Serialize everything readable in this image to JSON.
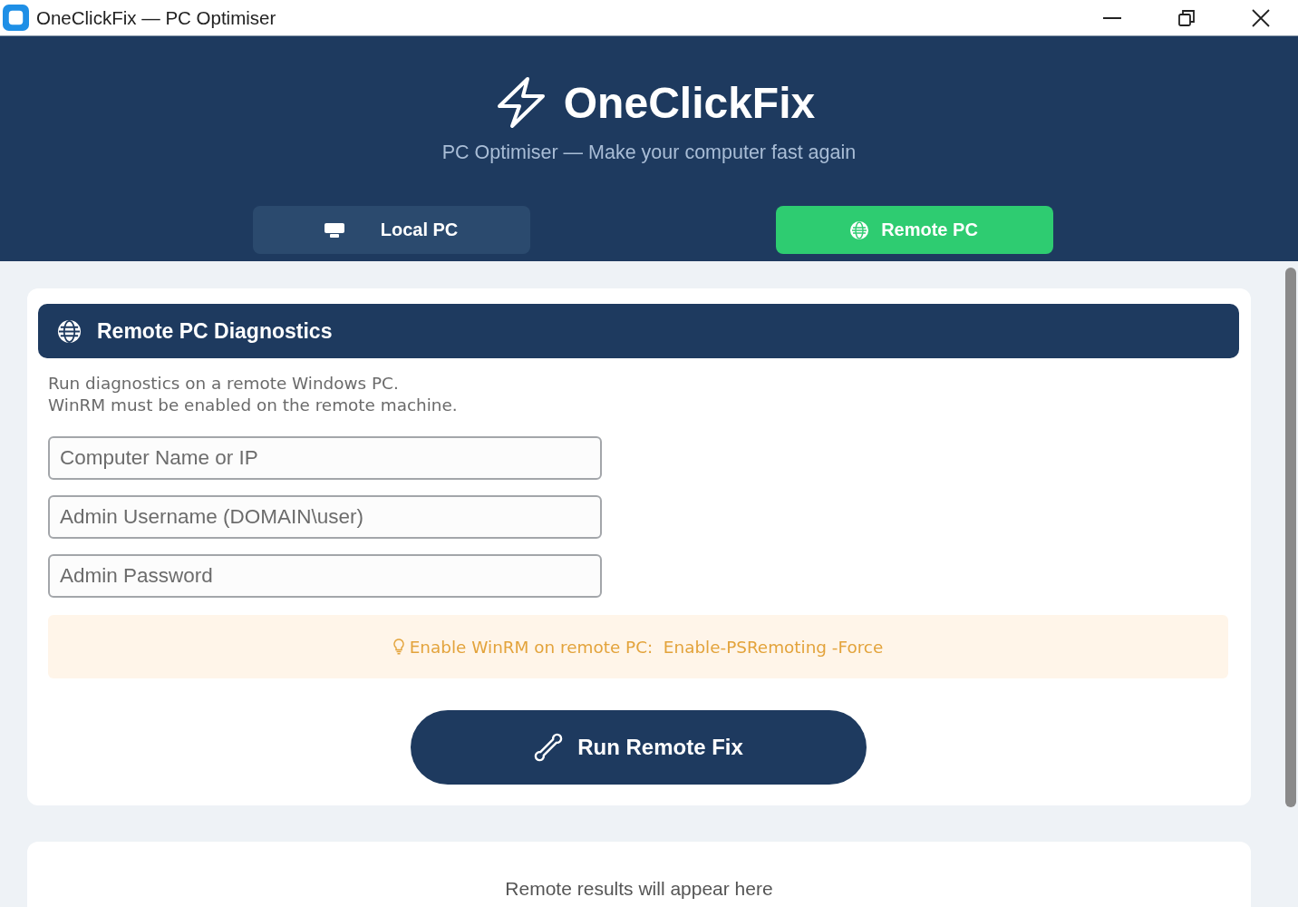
{
  "window": {
    "title": "OneClickFix — PC Optimiser"
  },
  "header": {
    "app_name": "OneClickFix",
    "tagline": "PC Optimiser — Make your computer fast again"
  },
  "tabs": [
    {
      "label": "Local PC",
      "selected": false,
      "kind": "local"
    },
    {
      "label": "Remote PC",
      "selected": true,
      "kind": "remote"
    }
  ],
  "remote_panel": {
    "title": "Remote PC Diagnostics",
    "description": "Run diagnostics on a remote Windows PC.\nWinRM must be enabled on the remote machine.",
    "fields": [
      {
        "placeholder": "Computer Name or IP"
      },
      {
        "placeholder": "Admin Username (DOMAIN\\user)"
      },
      {
        "placeholder": "Admin Password"
      }
    ],
    "tip": "Enable WinRM on remote PC:  Enable-PSRemoting -Force",
    "run_button": "Run Remote Fix"
  },
  "results": {
    "placeholder_text": "Remote results will appear here"
  }
}
